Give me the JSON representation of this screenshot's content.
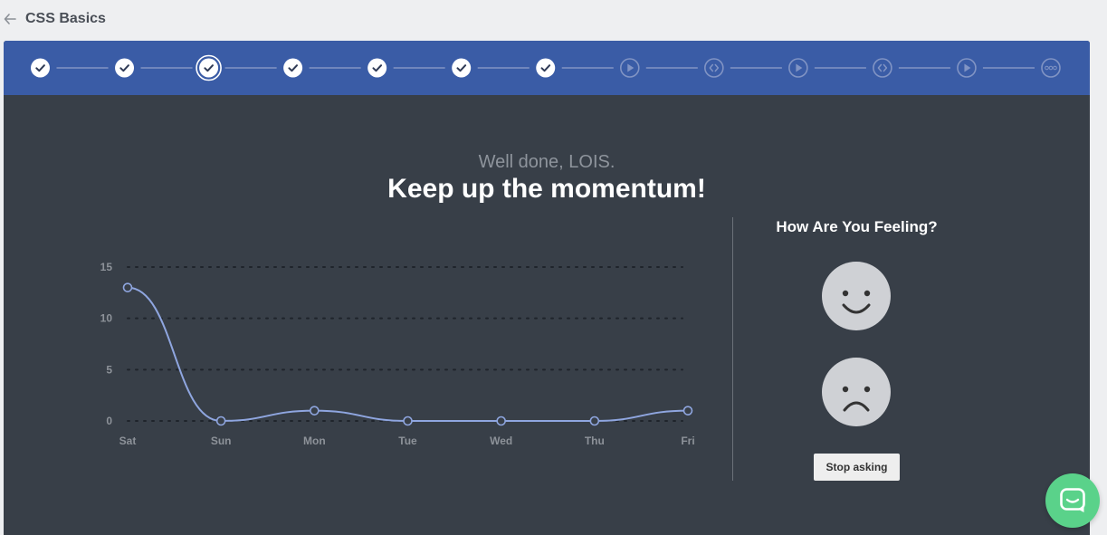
{
  "header": {
    "title": "CSS Basics",
    "back_icon": "arrow-left-icon"
  },
  "progress": {
    "steps": [
      {
        "status": "completed",
        "icon": "check-icon"
      },
      {
        "status": "completed",
        "icon": "check-icon"
      },
      {
        "status": "current",
        "icon": "check-icon"
      },
      {
        "status": "completed",
        "icon": "check-icon"
      },
      {
        "status": "completed",
        "icon": "check-icon"
      },
      {
        "status": "completed",
        "icon": "check-icon"
      },
      {
        "status": "completed",
        "icon": "check-icon"
      },
      {
        "status": "locked",
        "icon": "play-icon"
      },
      {
        "status": "locked",
        "icon": "code-icon"
      },
      {
        "status": "locked",
        "icon": "play-icon"
      },
      {
        "status": "locked",
        "icon": "code-icon"
      },
      {
        "status": "locked",
        "icon": "play-icon"
      },
      {
        "status": "locked",
        "icon": "more-icon"
      }
    ],
    "colors": {
      "bar": "#3a5ca6",
      "done": "#ffffff",
      "locked": "#8194c4"
    }
  },
  "main": {
    "greeting": "Well done, LOIS.",
    "headline": "Keep up the momentum!"
  },
  "chart_data": {
    "type": "line",
    "categories": [
      "Sat",
      "Sun",
      "Mon",
      "Tue",
      "Wed",
      "Thu",
      "Fri"
    ],
    "values": [
      13,
      0,
      1,
      0,
      0,
      0,
      1
    ],
    "yticks": [
      0,
      5,
      10,
      15
    ],
    "ylim": [
      0,
      15
    ],
    "grid": true,
    "line_color": "#8fa6e0"
  },
  "feeling": {
    "title": "How Are You Feeling?",
    "happy_icon": "happy-face-icon",
    "sad_icon": "sad-face-icon",
    "stop_label": "Stop asking"
  },
  "chat": {
    "icon": "chat-icon",
    "color": "#5ad28a"
  }
}
